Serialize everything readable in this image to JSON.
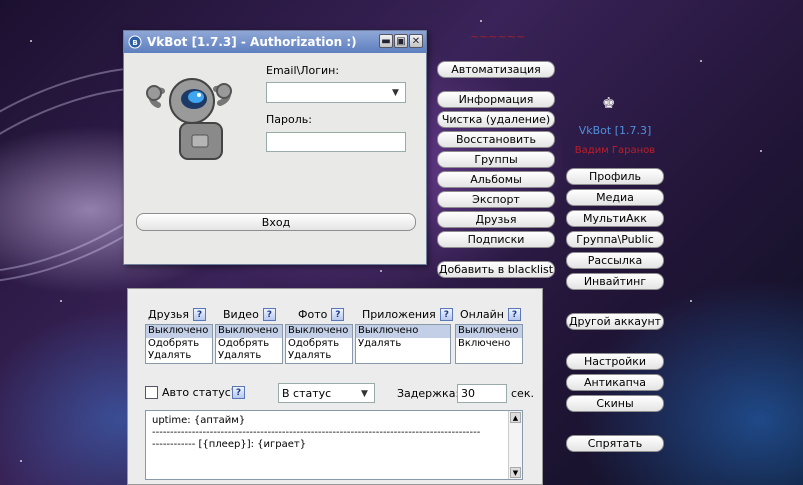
{
  "auth_window": {
    "title": "VkBot [1.7.3] - Authorization :)",
    "email_label": "Email\\Логин:",
    "email_value": "",
    "password_label": "Пароль:",
    "login_button": "Вход"
  },
  "brand": {
    "app_name": "VkBot [1.7.3]",
    "author": "Вадим Гаранов"
  },
  "left_menu": [
    "Автоматизация",
    "Информация",
    "Чистка (удаление)",
    "Восстановить",
    "Группы",
    "Альбомы",
    "Экспорт",
    "Друзья",
    "Подписки",
    "Добавить в blacklist"
  ],
  "right_menu": [
    "Профиль",
    "Медиа",
    "МультиАкк",
    "Группа\\Public",
    "Рассылка",
    "Инвайтинг",
    "Другой аккаунт",
    "Настройки",
    "Антикапча",
    "Скины",
    "Спрятать"
  ],
  "filters": {
    "columns": [
      {
        "label": "Друзья",
        "options": [
          "Выключено",
          "Одобрять",
          "Удалять"
        ],
        "selected": 0
      },
      {
        "label": "Видео",
        "options": [
          "Выключено",
          "Одобрять",
          "Удалять"
        ],
        "selected": 0
      },
      {
        "label": "Фото",
        "options": [
          "Выключено",
          "Одобрять",
          "Удалять"
        ],
        "selected": 0
      },
      {
        "label": "Приложения",
        "options": [
          "Выключено",
          "Удалять"
        ],
        "selected": 0
      },
      {
        "label": "Онлайн",
        "options": [
          "Выключено",
          "Включено"
        ],
        "selected": 0
      }
    ],
    "help_glyph": "?"
  },
  "status": {
    "auto_status_label": "Авто статус?",
    "auto_status_checked": false,
    "target_select": "В статус",
    "delay_label": "Задержка:",
    "delay_value": "30",
    "delay_unit": "сек.",
    "template_lines": [
      "uptime: {аптайм}",
      "-------------------------------------------------------------------------------------------",
      "------------ [{плеер}]: {играет}"
    ]
  },
  "colors": {
    "titlebar": "#5d7fbf",
    "app_name": "#4f8fe0",
    "author": "#c01c28"
  }
}
